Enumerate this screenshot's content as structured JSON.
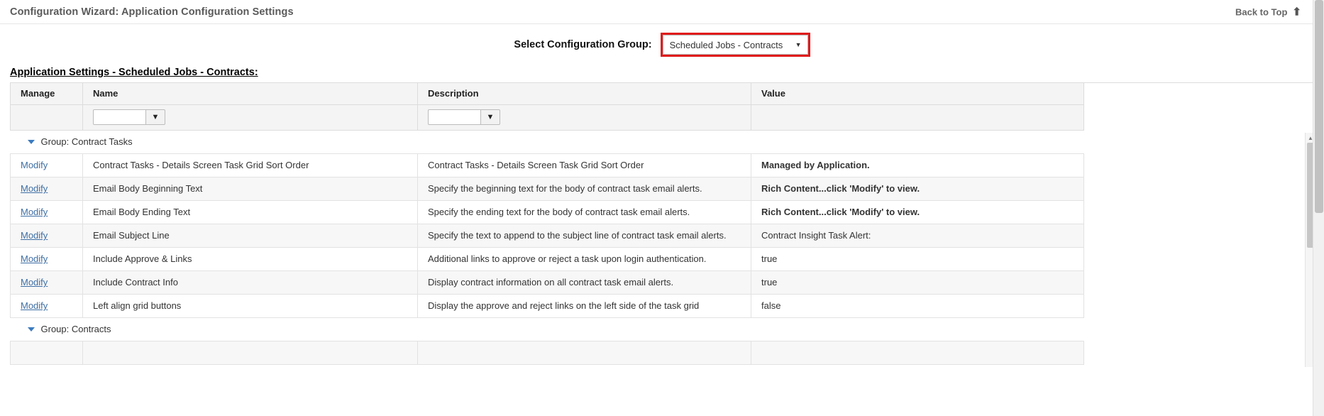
{
  "header": {
    "title": "Configuration Wizard: Application Configuration Settings",
    "back_to_top": "Back to Top",
    "back_to_top_icon": "arrow-up-icon"
  },
  "selector": {
    "label": "Select Configuration Group:",
    "selected_value": "Scheduled Jobs - Contracts",
    "chevron_icon": "chevron-down-icon",
    "highlight_color": "#e01b1b"
  },
  "section": {
    "heading": "Application Settings - Scheduled Jobs - Contracts:"
  },
  "grid": {
    "columns": [
      "Manage",
      "Name",
      "Description",
      "Value"
    ],
    "filters": {
      "name_value": "",
      "name_placeholder": "",
      "description_value": "",
      "description_placeholder": "",
      "funnel_icon": "funnel-icon",
      "filter_button_label": ""
    },
    "groups": [
      {
        "label": "Group: Contract Tasks",
        "toggle_icon": "triangle-down-icon",
        "rows": [
          {
            "manage": "Modify",
            "name": "Contract Tasks - Details Screen Task Grid Sort Order",
            "description": "Contract Tasks - Details Screen Task Grid Sort Order",
            "value": "Managed by Application.",
            "value_bold": true
          },
          {
            "manage": "Modify",
            "name": "Email Body Beginning Text",
            "description": "Specify the beginning text for the body of contract task email alerts.",
            "value": "Rich Content...click 'Modify' to view.",
            "value_bold": true
          },
          {
            "manage": "Modify",
            "name": "Email Body Ending Text",
            "description": "Specify the ending text for the body of contract task email alerts.",
            "value": "Rich Content...click 'Modify' to view.",
            "value_bold": true
          },
          {
            "manage": "Modify",
            "name": "Email Subject Line",
            "description": "Specify the text to append to the subject line of contract task email alerts.",
            "value": "Contract Insight Task Alert:",
            "value_bold": false
          },
          {
            "manage": "Modify",
            "name": "Include Approve & Links",
            "description": "Additional links to approve or reject a task upon login authentication.",
            "value": "true",
            "value_bold": false
          },
          {
            "manage": "Modify",
            "name": "Include Contract Info",
            "description": "Display contract information on all contract task email alerts.",
            "value": "true",
            "value_bold": false
          },
          {
            "manage": "Modify",
            "name": "Left align grid buttons",
            "description": "Display the approve and reject links on the left side of the task grid",
            "value": "false",
            "value_bold": false
          }
        ]
      },
      {
        "label": "Group: Contracts",
        "toggle_icon": "triangle-down-icon",
        "rows": []
      }
    ]
  },
  "scrollbars": {
    "grid_up_arrow": "▲",
    "grid_down_arrow": "▼"
  }
}
